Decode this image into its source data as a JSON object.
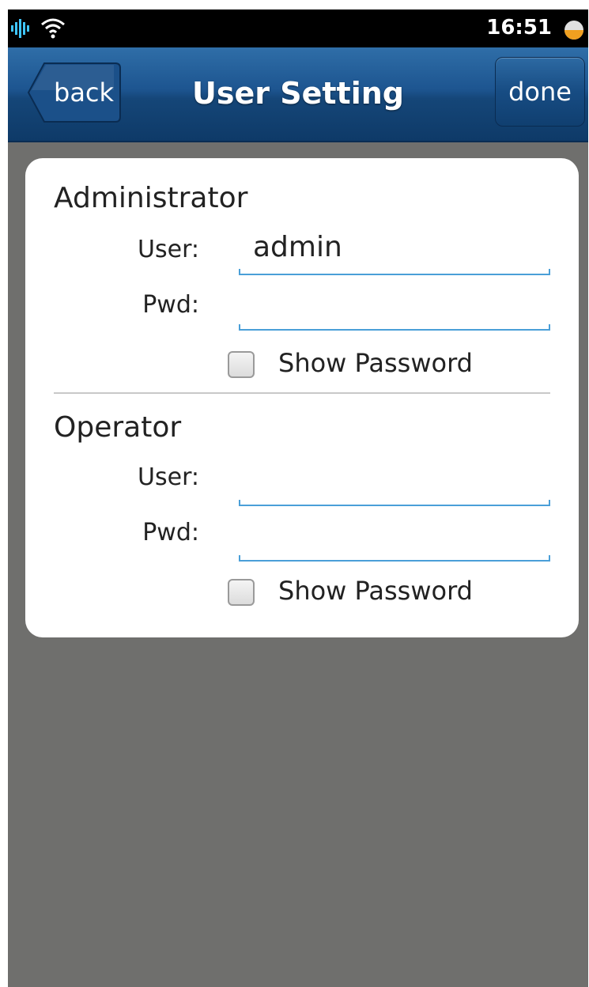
{
  "status_bar": {
    "time": "16:51",
    "icons": [
      "signal-icon",
      "wifi-icon",
      "battery-icon"
    ]
  },
  "header": {
    "title": "User Setting",
    "back_label": "back",
    "done_label": "done"
  },
  "administrator": {
    "section_title": "Administrator",
    "user_label": "User:",
    "user_value": "admin",
    "pwd_label": "Pwd:",
    "pwd_value": "",
    "show_password_label": "Show Password",
    "show_password_checked": false
  },
  "operator": {
    "section_title": "Operator",
    "user_label": "User:",
    "user_value": "",
    "pwd_label": "Pwd:",
    "pwd_value": "",
    "show_password_label": "Show Password",
    "show_password_checked": false
  },
  "colors": {
    "header_blue": "#1d5590",
    "background_gray": "#6f6f6d",
    "field_underline": "#4a9fd8"
  }
}
